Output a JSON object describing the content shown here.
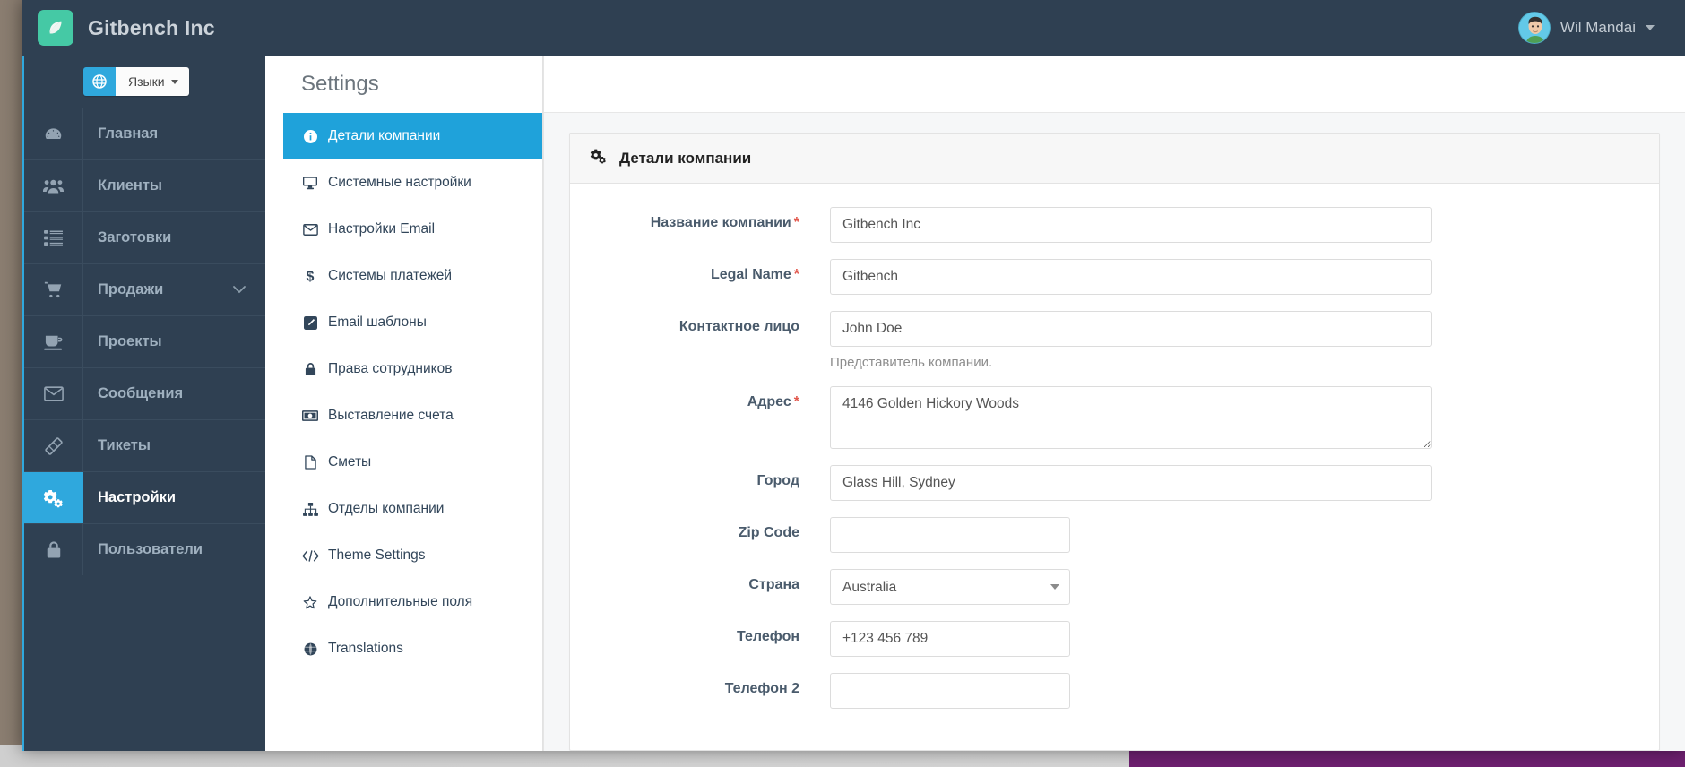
{
  "topbar": {
    "logo_icon": "leaf-logo-icon",
    "brand": "Gitbench Inc",
    "user": {
      "name": "Wil Mandai",
      "avatar_icon": "user-avatar",
      "caret_icon": "chevron-down-icon"
    }
  },
  "sidebar": {
    "language_button": {
      "globe_icon": "globe-icon",
      "label": "Языки",
      "caret_icon": "caret-down-icon"
    },
    "items": [
      {
        "label": "Главная",
        "icon": "dashboard-icon",
        "active": false,
        "expandable": false
      },
      {
        "label": "Клиенты",
        "icon": "users-icon",
        "active": false,
        "expandable": false
      },
      {
        "label": "Заготовки",
        "icon": "list-icon",
        "active": false,
        "expandable": false
      },
      {
        "label": "Продажи",
        "icon": "cart-icon",
        "active": false,
        "expandable": true
      },
      {
        "label": "Проекты",
        "icon": "coffee-icon",
        "active": false,
        "expandable": false
      },
      {
        "label": "Сообщения",
        "icon": "envelope-icon",
        "active": false,
        "expandable": false
      },
      {
        "label": "Тикеты",
        "icon": "ticket-icon",
        "active": false,
        "expandable": false
      },
      {
        "label": "Настройки",
        "icon": "gears-icon",
        "active": true,
        "expandable": false
      },
      {
        "label": "Пользователи",
        "icon": "lock-icon",
        "active": false,
        "expandable": false
      }
    ]
  },
  "submenu": {
    "title": "Settings",
    "items": [
      {
        "label": "Детали компании",
        "icon": "info-circle-icon",
        "active": true
      },
      {
        "label": "Системные настройки",
        "icon": "desktop-icon",
        "active": false
      },
      {
        "label": "Настройки Email",
        "icon": "envelope-open-icon",
        "active": false
      },
      {
        "label": "Системы платежей",
        "icon": "dollar-icon",
        "active": false
      },
      {
        "label": "Email шаблоны",
        "icon": "pencil-square-icon",
        "active": false
      },
      {
        "label": "Права сотрудников",
        "icon": "lock-icon",
        "active": false
      },
      {
        "label": "Выставление счета",
        "icon": "money-icon",
        "active": false
      },
      {
        "label": "Сметы",
        "icon": "file-icon",
        "active": false
      },
      {
        "label": "Отделы компании",
        "icon": "sitemap-icon",
        "active": false
      },
      {
        "label": "Theme Settings",
        "icon": "code-icon",
        "active": false
      },
      {
        "label": "Дополнительные поля",
        "icon": "star-icon",
        "active": false
      },
      {
        "label": "Translations",
        "icon": "globe-icon",
        "active": false
      }
    ]
  },
  "card": {
    "icon": "gears-icon",
    "title": "Детали компании",
    "fields": [
      {
        "label": "Название компании",
        "required": true,
        "type": "text",
        "value": "Gitbench Inc",
        "placeholder": "",
        "width": "wide",
        "help": ""
      },
      {
        "label": "Legal Name",
        "required": true,
        "type": "text",
        "value": "Gitbench",
        "placeholder": "",
        "width": "wide",
        "help": ""
      },
      {
        "label": "Контактное лицо",
        "required": false,
        "type": "text",
        "value": "John Doe",
        "placeholder": "",
        "width": "wide",
        "help": "Представитель компании."
      },
      {
        "label": "Адрес",
        "required": true,
        "type": "textarea",
        "value": "4146 Golden Hickory Woods",
        "placeholder": "",
        "width": "wide",
        "help": ""
      },
      {
        "label": "Город",
        "required": false,
        "type": "text",
        "value": "Glass Hill, Sydney",
        "placeholder": "",
        "width": "wide",
        "help": ""
      },
      {
        "label": "Zip Code",
        "required": false,
        "type": "text",
        "value": "",
        "placeholder": "",
        "width": "narrow",
        "help": ""
      },
      {
        "label": "Страна",
        "required": false,
        "type": "select",
        "value": "Australia",
        "placeholder": "",
        "width": "narrow",
        "help": ""
      },
      {
        "label": "Телефон",
        "required": false,
        "type": "text",
        "value": "+123 456 789",
        "placeholder": "",
        "width": "narrow",
        "help": ""
      },
      {
        "label": "Телефон 2",
        "required": false,
        "type": "text",
        "value": "",
        "placeholder": "",
        "width": "narrow",
        "help": ""
      }
    ]
  },
  "colors": {
    "sidebar_bg": "#2f4052",
    "accent": "#2fa8dd",
    "logo_green": "#45c9a5",
    "required_red": "#e2574c",
    "label_text": "#4a5b6c"
  }
}
